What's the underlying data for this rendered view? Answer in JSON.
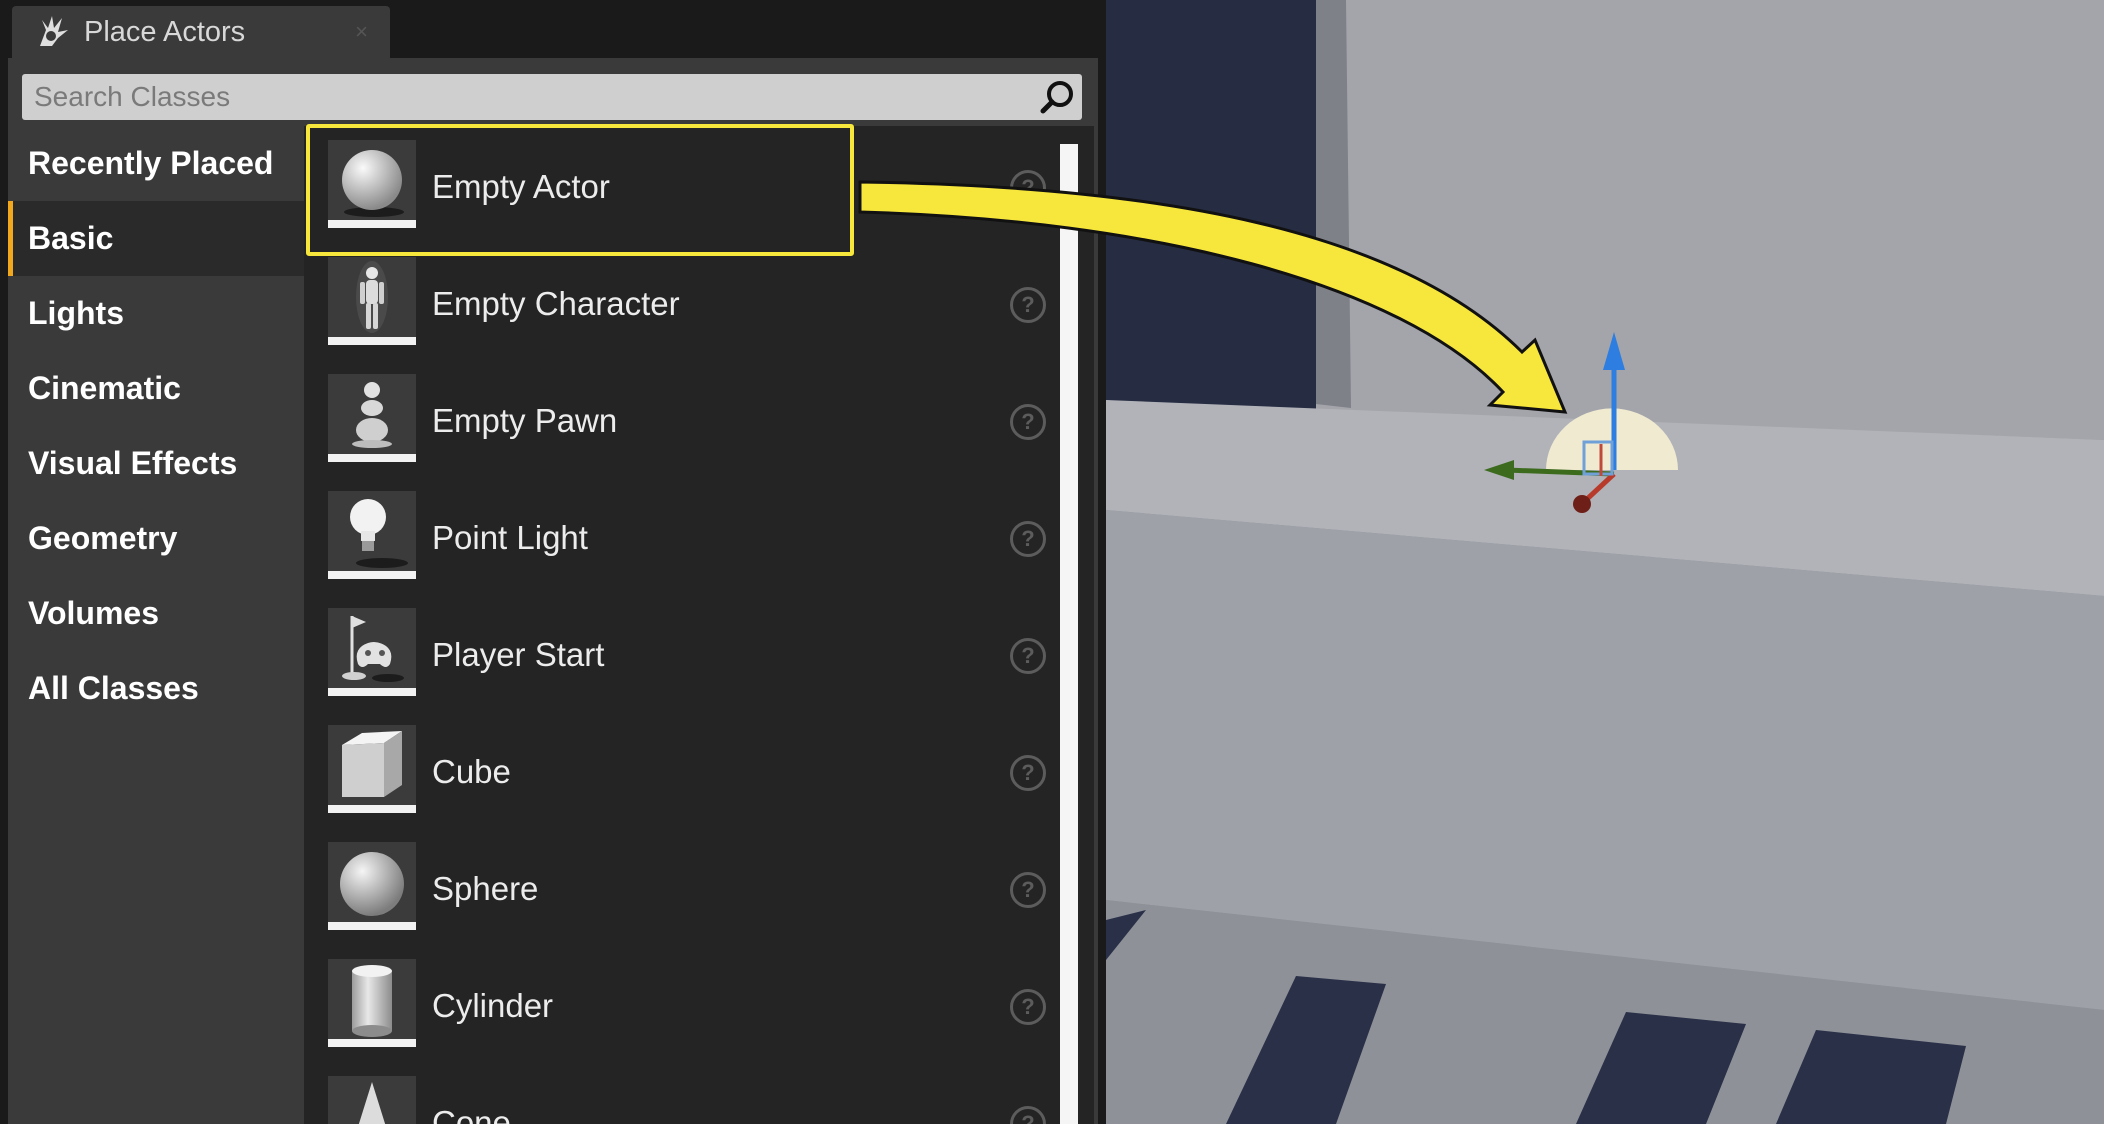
{
  "panel": {
    "tab_title": "Place Actors",
    "close_glyph": "×",
    "search_placeholder": "Search Classes",
    "search_icon": "search-icon"
  },
  "categories": [
    {
      "label": "Recently Placed",
      "active": false
    },
    {
      "label": "Basic",
      "active": true
    },
    {
      "label": "Lights",
      "active": false
    },
    {
      "label": "Cinematic",
      "active": false
    },
    {
      "label": "Visual Effects",
      "active": false
    },
    {
      "label": "Geometry",
      "active": false
    },
    {
      "label": "Volumes",
      "active": false
    },
    {
      "label": "All Classes",
      "active": false
    }
  ],
  "items": [
    {
      "label": "Empty Actor",
      "icon": "sphere-icon",
      "highlighted": true
    },
    {
      "label": "Empty Character",
      "icon": "mannequin-icon"
    },
    {
      "label": "Empty Pawn",
      "icon": "pawn-icon"
    },
    {
      "label": "Point Light",
      "icon": "lightbulb-icon"
    },
    {
      "label": "Player Start",
      "icon": "player-start-icon"
    },
    {
      "label": "Cube",
      "icon": "cube-icon"
    },
    {
      "label": "Sphere",
      "icon": "sphere-icon"
    },
    {
      "label": "Cylinder",
      "icon": "cylinder-icon"
    },
    {
      "label": "Cone",
      "icon": "cone-icon"
    }
  ],
  "colors": {
    "active_accent": "#f2a81d",
    "highlight": "#f7e63b",
    "arrow": "#f7e63b",
    "gizmo_z": "#2e7de0",
    "gizmo_x": "#b83a2b",
    "gizmo_y": "#3d6b1e"
  }
}
